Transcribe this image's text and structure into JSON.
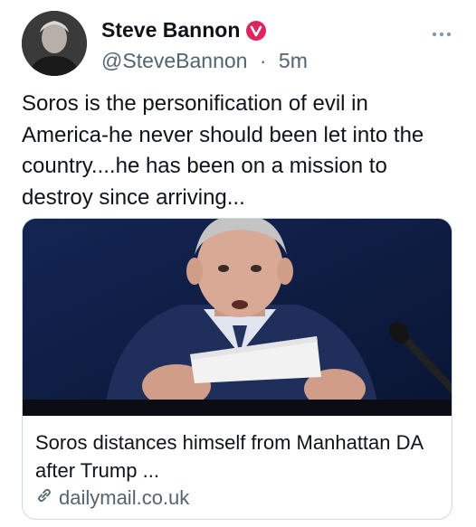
{
  "author": {
    "display_name": "Steve Bannon",
    "handle": "@SteveBannon",
    "separator": "·",
    "timestamp": "5m",
    "verified_badge_color": "#e0245e"
  },
  "post": {
    "text": "Soros is the personification of evil in America-he never should been let into the country....he has been on a mission to destroy since arriving..."
  },
  "link_card": {
    "title": "Soros distances himself from Manhattan DA after Trump ...",
    "domain": "dailymail.co.uk"
  },
  "icons": {
    "more": "more-horizontal-icon",
    "verified": "verified-badge-icon",
    "link": "link-icon"
  }
}
